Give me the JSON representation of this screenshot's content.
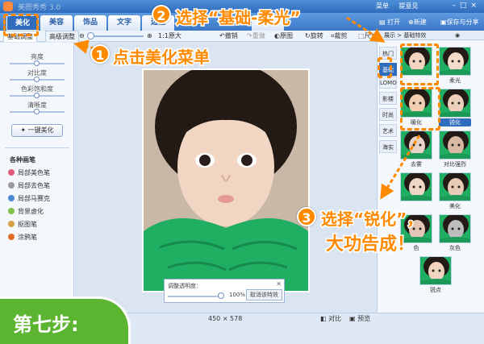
{
  "window": {
    "title": "美图秀秀 3.0",
    "links": [
      "菜单",
      "提意见"
    ]
  },
  "menu": {
    "tabs": [
      "美化",
      "美容",
      "饰品",
      "文字",
      "边框",
      "拼"
    ],
    "right_buttons": [
      "打开",
      "新建",
      "保存与分享"
    ]
  },
  "toolbar": {
    "subtabs": [
      "基础调整",
      "高级调整"
    ],
    "zoom_label": "1:1原大",
    "tools": [
      "撤销",
      "重做",
      "原图",
      "旋转",
      "裁剪",
      "尺寸"
    ]
  },
  "left_panel": {
    "adjustments": [
      {
        "label": "亮度",
        "value": 0.5
      },
      {
        "label": "对比度",
        "value": 0.5
      },
      {
        "label": "色彩饱和度",
        "value": 0.5
      },
      {
        "label": "清晰度",
        "value": 0.5
      }
    ],
    "onekey_label": "一键美化",
    "brushes_title": "各种画笔",
    "brushes": [
      "局部美色笔",
      "局部去色笔",
      "局部马赛克",
      "背景虚化",
      "抠图笔",
      "涂鸦笔"
    ],
    "brush_colors": [
      "#e05a7a",
      "#9a9a9a",
      "#4a8ad0",
      "#7fbf4a",
      "#d9a04a",
      "#e06a2a"
    ]
  },
  "transparency": {
    "label": "调整透明度：",
    "value_text": "100%",
    "value": 1.0,
    "cancel_label": "取消该特效"
  },
  "status": {
    "size_text": "450 × 578",
    "compare_label": "对比",
    "preview_label": "预览"
  },
  "right_panel": {
    "header": "展示 > 基础特效",
    "categories": [
      "热门",
      "基础",
      "LOMO",
      "影楼",
      "时尚",
      "艺术",
      "海实"
    ],
    "effects": [
      "",
      "柔光",
      "暖化",
      "锐化",
      "去雾",
      "对比强烈",
      "",
      "美化",
      "色",
      "灰色",
      "锐点"
    ]
  },
  "annotations": {
    "step1": "点击美化菜单",
    "step2": "选择“基础-柔光”",
    "step3_line1": "选择“锐化”，",
    "step3_line2": "大功告成！",
    "num1": "1",
    "num2": "2",
    "num3": "3",
    "badge": "第七步:"
  },
  "colors": {
    "accent": "#ff8a00",
    "brand": "#2f6cbd",
    "badge": "#5cb531",
    "scarf": "#1fae62"
  }
}
